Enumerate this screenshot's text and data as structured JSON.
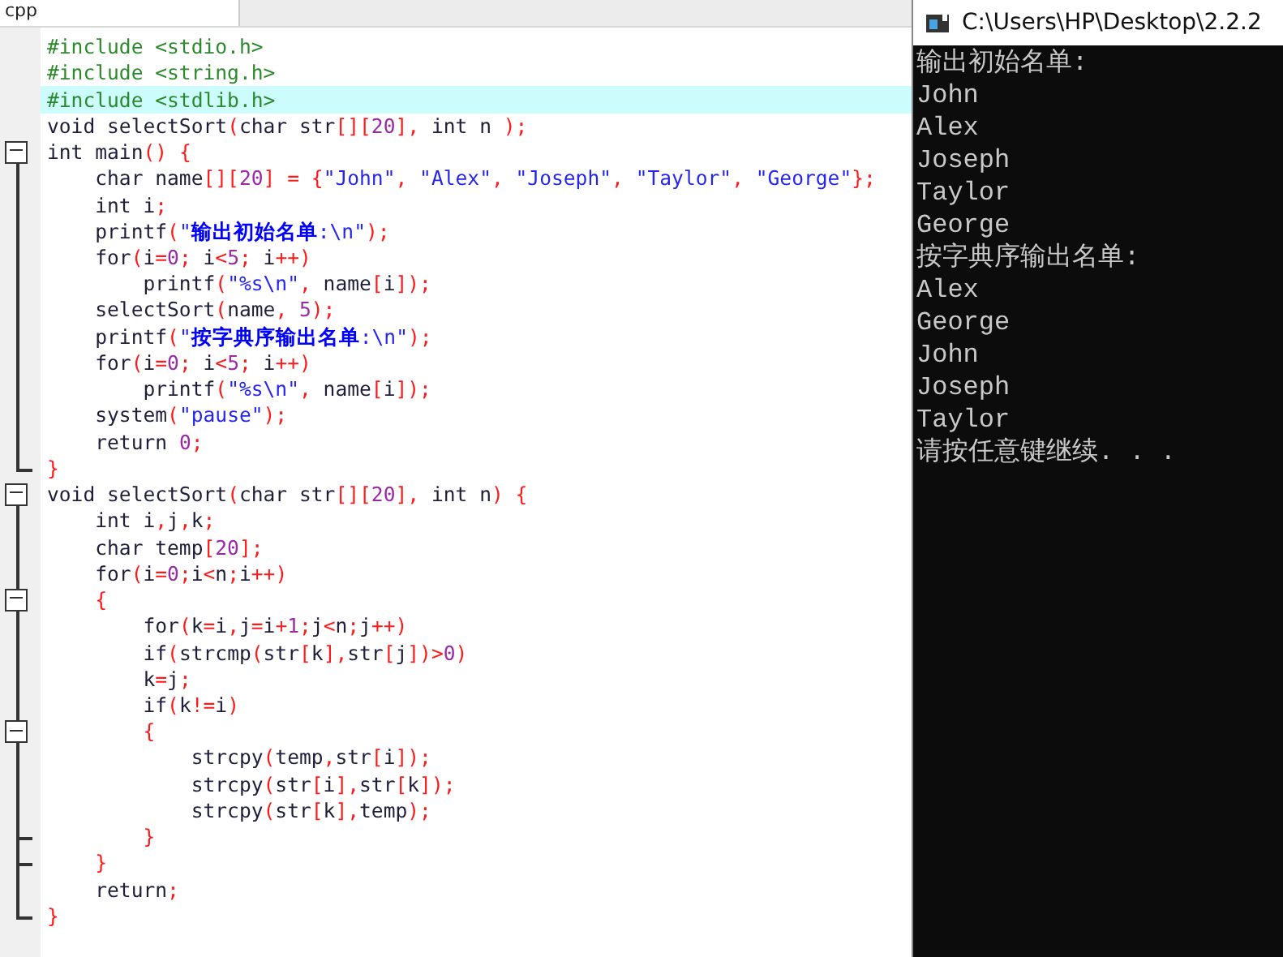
{
  "editor": {
    "tab": {
      "label": "cpp",
      "selected": true
    },
    "lines": [
      {
        "kind": "body",
        "highlighted": false,
        "tokens": [
          {
            "text": "#include <stdio.h>",
            "kind": "dir"
          }
        ]
      },
      {
        "kind": "body",
        "highlighted": false,
        "tokens": [
          {
            "text": "#include <string.h>",
            "kind": "dir"
          }
        ]
      },
      {
        "kind": "body",
        "highlighted": true,
        "tokens": [
          {
            "text": "#include <stdlib.h>",
            "kind": "dir"
          }
        ]
      },
      {
        "kind": "body",
        "highlighted": false,
        "tokens": [
          {
            "text": "void selectSort",
            "kind": "plain"
          },
          {
            "text": "(",
            "kind": "op"
          },
          {
            "text": "char str",
            "kind": "plain"
          },
          {
            "text": "[][",
            "kind": "op"
          },
          {
            "text": "20",
            "kind": "num"
          },
          {
            "text": "],",
            "kind": "op"
          },
          {
            "text": " int n ",
            "kind": "plain"
          },
          {
            "text": ");",
            "kind": "op"
          }
        ]
      },
      {
        "kind": "start",
        "highlighted": false,
        "tokens": [
          {
            "text": "int main",
            "kind": "plain"
          },
          {
            "text": "() {",
            "kind": "op"
          }
        ]
      },
      {
        "kind": "body",
        "highlighted": false,
        "tokens": [
          {
            "text": "    char name",
            "kind": "plain"
          },
          {
            "text": "[][",
            "kind": "op"
          },
          {
            "text": "20",
            "kind": "num"
          },
          {
            "text": "] = {",
            "kind": "op"
          },
          {
            "text": "\"John\"",
            "kind": "str"
          },
          {
            "text": ", ",
            "kind": "op"
          },
          {
            "text": "\"Alex\"",
            "kind": "str"
          },
          {
            "text": ", ",
            "kind": "op"
          },
          {
            "text": "\"Joseph\"",
            "kind": "str"
          },
          {
            "text": ", ",
            "kind": "op"
          },
          {
            "text": "\"Taylor\"",
            "kind": "str"
          },
          {
            "text": ", ",
            "kind": "op"
          },
          {
            "text": "\"George\"",
            "kind": "str"
          },
          {
            "text": "};",
            "kind": "op"
          }
        ]
      },
      {
        "kind": "body",
        "highlighted": false,
        "tokens": [
          {
            "text": "    int i",
            "kind": "plain"
          },
          {
            "text": ";",
            "kind": "op"
          }
        ]
      },
      {
        "kind": "body",
        "highlighted": false,
        "tokens": [
          {
            "text": "    printf",
            "kind": "plain"
          },
          {
            "text": "(",
            "kind": "op"
          },
          {
            "text": "\"",
            "kind": "str"
          },
          {
            "text": "输出初始名单",
            "kind": "strong"
          },
          {
            "text": ":\\n\"",
            "kind": "str"
          },
          {
            "text": ");",
            "kind": "op"
          }
        ]
      },
      {
        "kind": "body",
        "highlighted": false,
        "tokens": [
          {
            "text": "    for",
            "kind": "plain"
          },
          {
            "text": "(",
            "kind": "op"
          },
          {
            "text": "i",
            "kind": "plain"
          },
          {
            "text": "=",
            "kind": "op"
          },
          {
            "text": "0",
            "kind": "num"
          },
          {
            "text": ";",
            "kind": "op"
          },
          {
            "text": " i",
            "kind": "plain"
          },
          {
            "text": "<",
            "kind": "op"
          },
          {
            "text": "5",
            "kind": "num"
          },
          {
            "text": ";",
            "kind": "op"
          },
          {
            "text": " i",
            "kind": "plain"
          },
          {
            "text": "++)",
            "kind": "op"
          }
        ]
      },
      {
        "kind": "body",
        "highlighted": false,
        "tokens": [
          {
            "text": "        printf",
            "kind": "plain"
          },
          {
            "text": "(",
            "kind": "op"
          },
          {
            "text": "\"%s\\n\"",
            "kind": "str"
          },
          {
            "text": ", ",
            "kind": "op"
          },
          {
            "text": "name",
            "kind": "plain"
          },
          {
            "text": "[",
            "kind": "op"
          },
          {
            "text": "i",
            "kind": "plain"
          },
          {
            "text": "]);",
            "kind": "op"
          }
        ]
      },
      {
        "kind": "body",
        "highlighted": false,
        "tokens": [
          {
            "text": "    selectSort",
            "kind": "plain"
          },
          {
            "text": "(",
            "kind": "op"
          },
          {
            "text": "name",
            "kind": "plain"
          },
          {
            "text": ", ",
            "kind": "op"
          },
          {
            "text": "5",
            "kind": "num"
          },
          {
            "text": ");",
            "kind": "op"
          }
        ]
      },
      {
        "kind": "body",
        "highlighted": false,
        "tokens": [
          {
            "text": "    printf",
            "kind": "plain"
          },
          {
            "text": "(",
            "kind": "op"
          },
          {
            "text": "\"",
            "kind": "str"
          },
          {
            "text": "按字典序输出名单",
            "kind": "strong"
          },
          {
            "text": ":\\n\"",
            "kind": "str"
          },
          {
            "text": ");",
            "kind": "op"
          }
        ]
      },
      {
        "kind": "body",
        "highlighted": false,
        "tokens": [
          {
            "text": "    for",
            "kind": "plain"
          },
          {
            "text": "(",
            "kind": "op"
          },
          {
            "text": "i",
            "kind": "plain"
          },
          {
            "text": "=",
            "kind": "op"
          },
          {
            "text": "0",
            "kind": "num"
          },
          {
            "text": ";",
            "kind": "op"
          },
          {
            "text": " i",
            "kind": "plain"
          },
          {
            "text": "<",
            "kind": "op"
          },
          {
            "text": "5",
            "kind": "num"
          },
          {
            "text": ";",
            "kind": "op"
          },
          {
            "text": " i",
            "kind": "plain"
          },
          {
            "text": "++)",
            "kind": "op"
          }
        ]
      },
      {
        "kind": "body",
        "highlighted": false,
        "tokens": [
          {
            "text": "        printf",
            "kind": "plain"
          },
          {
            "text": "(",
            "kind": "op"
          },
          {
            "text": "\"%s\\n\"",
            "kind": "str"
          },
          {
            "text": ", ",
            "kind": "op"
          },
          {
            "text": "name",
            "kind": "plain"
          },
          {
            "text": "[",
            "kind": "op"
          },
          {
            "text": "i",
            "kind": "plain"
          },
          {
            "text": "]);",
            "kind": "op"
          }
        ]
      },
      {
        "kind": "body",
        "highlighted": false,
        "tokens": [
          {
            "text": "    system",
            "kind": "plain"
          },
          {
            "text": "(",
            "kind": "op"
          },
          {
            "text": "\"pause\"",
            "kind": "str"
          },
          {
            "text": ");",
            "kind": "op"
          }
        ]
      },
      {
        "kind": "body",
        "highlighted": false,
        "tokens": [
          {
            "text": "    return ",
            "kind": "plain"
          },
          {
            "text": "0",
            "kind": "num"
          },
          {
            "text": ";",
            "kind": "op"
          }
        ]
      },
      {
        "kind": "close",
        "highlighted": false,
        "tokens": [
          {
            "text": "}",
            "kind": "op"
          }
        ]
      },
      {
        "kind": "start",
        "highlighted": false,
        "tokens": [
          {
            "text": "void selectSort",
            "kind": "plain"
          },
          {
            "text": "(",
            "kind": "op"
          },
          {
            "text": "char str",
            "kind": "plain"
          },
          {
            "text": "[][",
            "kind": "op"
          },
          {
            "text": "20",
            "kind": "num"
          },
          {
            "text": "],",
            "kind": "op"
          },
          {
            "text": " int n",
            "kind": "plain"
          },
          {
            "text": ") {",
            "kind": "op"
          }
        ]
      },
      {
        "kind": "body",
        "highlighted": false,
        "tokens": [
          {
            "text": "    int i",
            "kind": "plain"
          },
          {
            "text": ",",
            "kind": "op"
          },
          {
            "text": "j",
            "kind": "plain"
          },
          {
            "text": ",",
            "kind": "op"
          },
          {
            "text": "k",
            "kind": "plain"
          },
          {
            "text": ";",
            "kind": "op"
          }
        ]
      },
      {
        "kind": "body",
        "highlighted": false,
        "tokens": [
          {
            "text": "    char temp",
            "kind": "plain"
          },
          {
            "text": "[",
            "kind": "op"
          },
          {
            "text": "20",
            "kind": "num"
          },
          {
            "text": "];",
            "kind": "op"
          }
        ]
      },
      {
        "kind": "body",
        "highlighted": false,
        "tokens": [
          {
            "text": "    for",
            "kind": "plain"
          },
          {
            "text": "(",
            "kind": "op"
          },
          {
            "text": "i",
            "kind": "plain"
          },
          {
            "text": "=",
            "kind": "op"
          },
          {
            "text": "0",
            "kind": "num"
          },
          {
            "text": ";",
            "kind": "op"
          },
          {
            "text": "i",
            "kind": "plain"
          },
          {
            "text": "<",
            "kind": "op"
          },
          {
            "text": "n",
            "kind": "plain"
          },
          {
            "text": ";",
            "kind": "op"
          },
          {
            "text": "i",
            "kind": "plain"
          },
          {
            "text": "++)",
            "kind": "op"
          }
        ]
      },
      {
        "kind": "start",
        "highlighted": false,
        "tokens": [
          {
            "text": "    {",
            "kind": "op"
          }
        ]
      },
      {
        "kind": "body",
        "highlighted": false,
        "tokens": [
          {
            "text": "        for",
            "kind": "plain"
          },
          {
            "text": "(",
            "kind": "op"
          },
          {
            "text": "k",
            "kind": "plain"
          },
          {
            "text": "=",
            "kind": "op"
          },
          {
            "text": "i",
            "kind": "plain"
          },
          {
            "text": ",",
            "kind": "op"
          },
          {
            "text": "j",
            "kind": "plain"
          },
          {
            "text": "=",
            "kind": "op"
          },
          {
            "text": "i",
            "kind": "plain"
          },
          {
            "text": "+",
            "kind": "op"
          },
          {
            "text": "1",
            "kind": "num"
          },
          {
            "text": ";",
            "kind": "op"
          },
          {
            "text": "j",
            "kind": "plain"
          },
          {
            "text": "<",
            "kind": "op"
          },
          {
            "text": "n",
            "kind": "plain"
          },
          {
            "text": ";",
            "kind": "op"
          },
          {
            "text": "j",
            "kind": "plain"
          },
          {
            "text": "++)",
            "kind": "op"
          }
        ]
      },
      {
        "kind": "body",
        "highlighted": false,
        "tokens": [
          {
            "text": "        if",
            "kind": "plain"
          },
          {
            "text": "(",
            "kind": "op"
          },
          {
            "text": "strcmp",
            "kind": "plain"
          },
          {
            "text": "(",
            "kind": "op"
          },
          {
            "text": "str",
            "kind": "plain"
          },
          {
            "text": "[",
            "kind": "op"
          },
          {
            "text": "k",
            "kind": "plain"
          },
          {
            "text": "],",
            "kind": "op"
          },
          {
            "text": "str",
            "kind": "plain"
          },
          {
            "text": "[",
            "kind": "op"
          },
          {
            "text": "j",
            "kind": "plain"
          },
          {
            "text": "])>",
            "kind": "op"
          },
          {
            "text": "0",
            "kind": "num"
          },
          {
            "text": ")",
            "kind": "op"
          }
        ]
      },
      {
        "kind": "body",
        "highlighted": false,
        "tokens": [
          {
            "text": "        k",
            "kind": "plain"
          },
          {
            "text": "=",
            "kind": "op"
          },
          {
            "text": "j",
            "kind": "plain"
          },
          {
            "text": ";",
            "kind": "op"
          }
        ]
      },
      {
        "kind": "body",
        "highlighted": false,
        "tokens": [
          {
            "text": "        if",
            "kind": "plain"
          },
          {
            "text": "(",
            "kind": "op"
          },
          {
            "text": "k",
            "kind": "plain"
          },
          {
            "text": "!=",
            "kind": "op"
          },
          {
            "text": "i",
            "kind": "plain"
          },
          {
            "text": ")",
            "kind": "op"
          }
        ]
      },
      {
        "kind": "start",
        "highlighted": false,
        "tokens": [
          {
            "text": "        {",
            "kind": "op"
          }
        ]
      },
      {
        "kind": "body",
        "highlighted": false,
        "tokens": [
          {
            "text": "            strcpy",
            "kind": "plain"
          },
          {
            "text": "(",
            "kind": "op"
          },
          {
            "text": "temp",
            "kind": "plain"
          },
          {
            "text": ",",
            "kind": "op"
          },
          {
            "text": "str",
            "kind": "plain"
          },
          {
            "text": "[",
            "kind": "op"
          },
          {
            "text": "i",
            "kind": "plain"
          },
          {
            "text": "]);",
            "kind": "op"
          }
        ]
      },
      {
        "kind": "body",
        "highlighted": false,
        "tokens": [
          {
            "text": "            strcpy",
            "kind": "plain"
          },
          {
            "text": "(",
            "kind": "op"
          },
          {
            "text": "str",
            "kind": "plain"
          },
          {
            "text": "[",
            "kind": "op"
          },
          {
            "text": "i",
            "kind": "plain"
          },
          {
            "text": "],",
            "kind": "op"
          },
          {
            "text": "str",
            "kind": "plain"
          },
          {
            "text": "[",
            "kind": "op"
          },
          {
            "text": "k",
            "kind": "plain"
          },
          {
            "text": "]);",
            "kind": "op"
          }
        ]
      },
      {
        "kind": "body",
        "highlighted": false,
        "tokens": [
          {
            "text": "            strcpy",
            "kind": "plain"
          },
          {
            "text": "(",
            "kind": "op"
          },
          {
            "text": "str",
            "kind": "plain"
          },
          {
            "text": "[",
            "kind": "op"
          },
          {
            "text": "k",
            "kind": "plain"
          },
          {
            "text": "],",
            "kind": "op"
          },
          {
            "text": "temp",
            "kind": "plain"
          },
          {
            "text": ");",
            "kind": "op"
          }
        ]
      },
      {
        "kind": "end",
        "highlighted": false,
        "tokens": [
          {
            "text": "        }",
            "kind": "op"
          }
        ]
      },
      {
        "kind": "end",
        "highlighted": false,
        "tokens": [
          {
            "text": "    }",
            "kind": "op"
          }
        ]
      },
      {
        "kind": "body",
        "highlighted": false,
        "tokens": [
          {
            "text": "    return",
            "kind": "plain"
          },
          {
            "text": ";",
            "kind": "op"
          }
        ]
      },
      {
        "kind": "close",
        "highlighted": false,
        "tokens": [
          {
            "text": "}",
            "kind": "op"
          }
        ]
      }
    ]
  },
  "console": {
    "title": "C:\\Users\\HP\\Desktop\\2.2.2",
    "lines": [
      "输出初始名单:",
      "John",
      "Alex",
      "Joseph",
      "Taylor",
      "George",
      "按字典序输出名单:",
      "Alex",
      "George",
      "John",
      "Joseph",
      "Taylor",
      "请按任意键继续. . ."
    ]
  }
}
